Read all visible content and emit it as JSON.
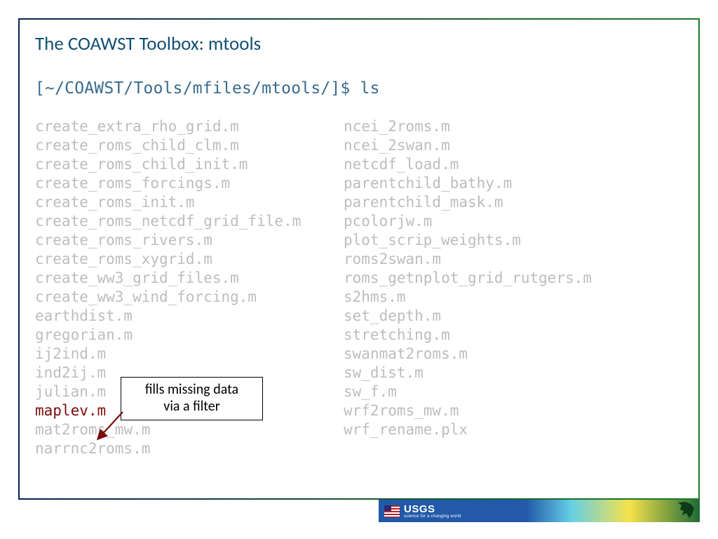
{
  "title": "The COAWST Toolbox: mtools",
  "prompt": "[~/COAWST/Tools/mfiles/mtools/]$ ls",
  "listing": {
    "col1": [
      "create_extra_rho_grid.m",
      "create_roms_child_clm.m",
      "create_roms_child_init.m",
      "create_roms_forcings.m",
      "create_roms_init.m",
      "create_roms_netcdf_grid_file.m",
      "create_roms_rivers.m",
      "create_roms_xygrid.m",
      "create_ww3_grid_files.m",
      "create_ww3_wind_forcing.m",
      "earthdist.m",
      "gregorian.m",
      "ij2ind.m",
      "ind2ij.m",
      "julian.m",
      "maplev.m",
      "mat2roms_mw.m",
      "narrnc2roms.m"
    ],
    "col2": [
      "ncei_2roms.m",
      "ncei_2swan.m",
      "netcdf_load.m",
      "parentchild_bathy.m",
      "parentchild_mask.m",
      "pcolorjw.m",
      "plot_scrip_weights.m",
      "roms2swan.m",
      "roms_getnplot_grid_rutgers.m",
      "s2hms.m",
      "set_depth.m",
      "stretching.m",
      "swanmat2roms.m",
      "sw_dist.m",
      "sw_f.m",
      "wrf2roms_mw.m",
      "wrf_rename.plx"
    ],
    "highlight": "maplev.m"
  },
  "callout": {
    "line1": "fills missing data",
    "line2": "via a filter"
  },
  "footer": {
    "agency_big": "USGS",
    "agency_small": "science for a changing world"
  }
}
